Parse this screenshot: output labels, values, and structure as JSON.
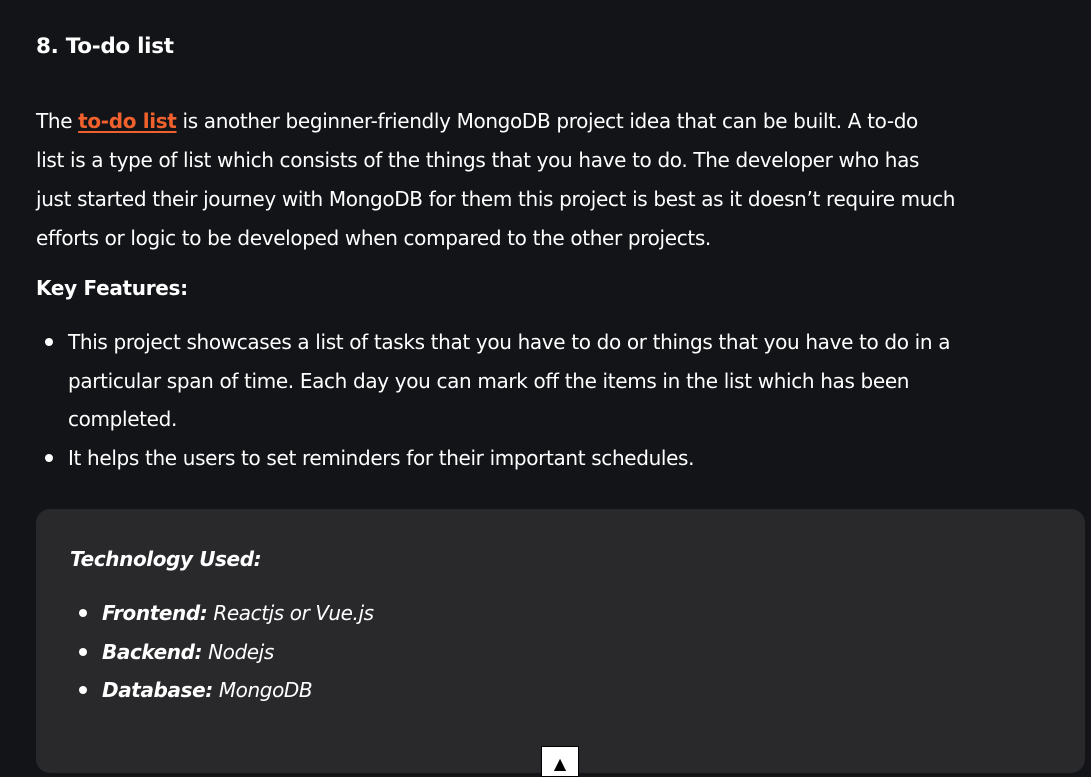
{
  "heading": "8. To-do list",
  "intro": {
    "prefix": "The",
    "link_text": "to-do list",
    "line1_rest": "is another beginner-friendly MongoDB project idea that can be built. A to-do",
    "line2": "list is a type of list which consists of the things that you have to do. The developer who has",
    "line3": "just started their journey with MongoDB for them this project is best as it doesn’t require much",
    "line4": "efforts or logic to be developed when compared to the other projects."
  },
  "key_features": {
    "label": "Key Features:",
    "items": [
      {
        "lines": [
          "This project showcases a list of tasks that you have to do or things that you have to do in a",
          "particular span of time. Each day you can mark off the items in the list which has been",
          "completed."
        ]
      },
      {
        "lines": [
          "It helps the users to set reminders for their important schedules."
        ]
      }
    ]
  },
  "technology": {
    "title": "Technology Used:",
    "items": [
      {
        "key": "Frontend:",
        "value": "Reactjs or Vue.js"
      },
      {
        "key": "Backend:",
        "value": "Nodejs"
      },
      {
        "key": "Database:",
        "value": "MongoDB"
      }
    ]
  },
  "scroll_top": {
    "glyph": "▲",
    "icon": "arrow-up-icon"
  },
  "colors": {
    "background": "#131418",
    "panel": "#29292c",
    "link": "#f0612d",
    "text": "#ffffff"
  }
}
